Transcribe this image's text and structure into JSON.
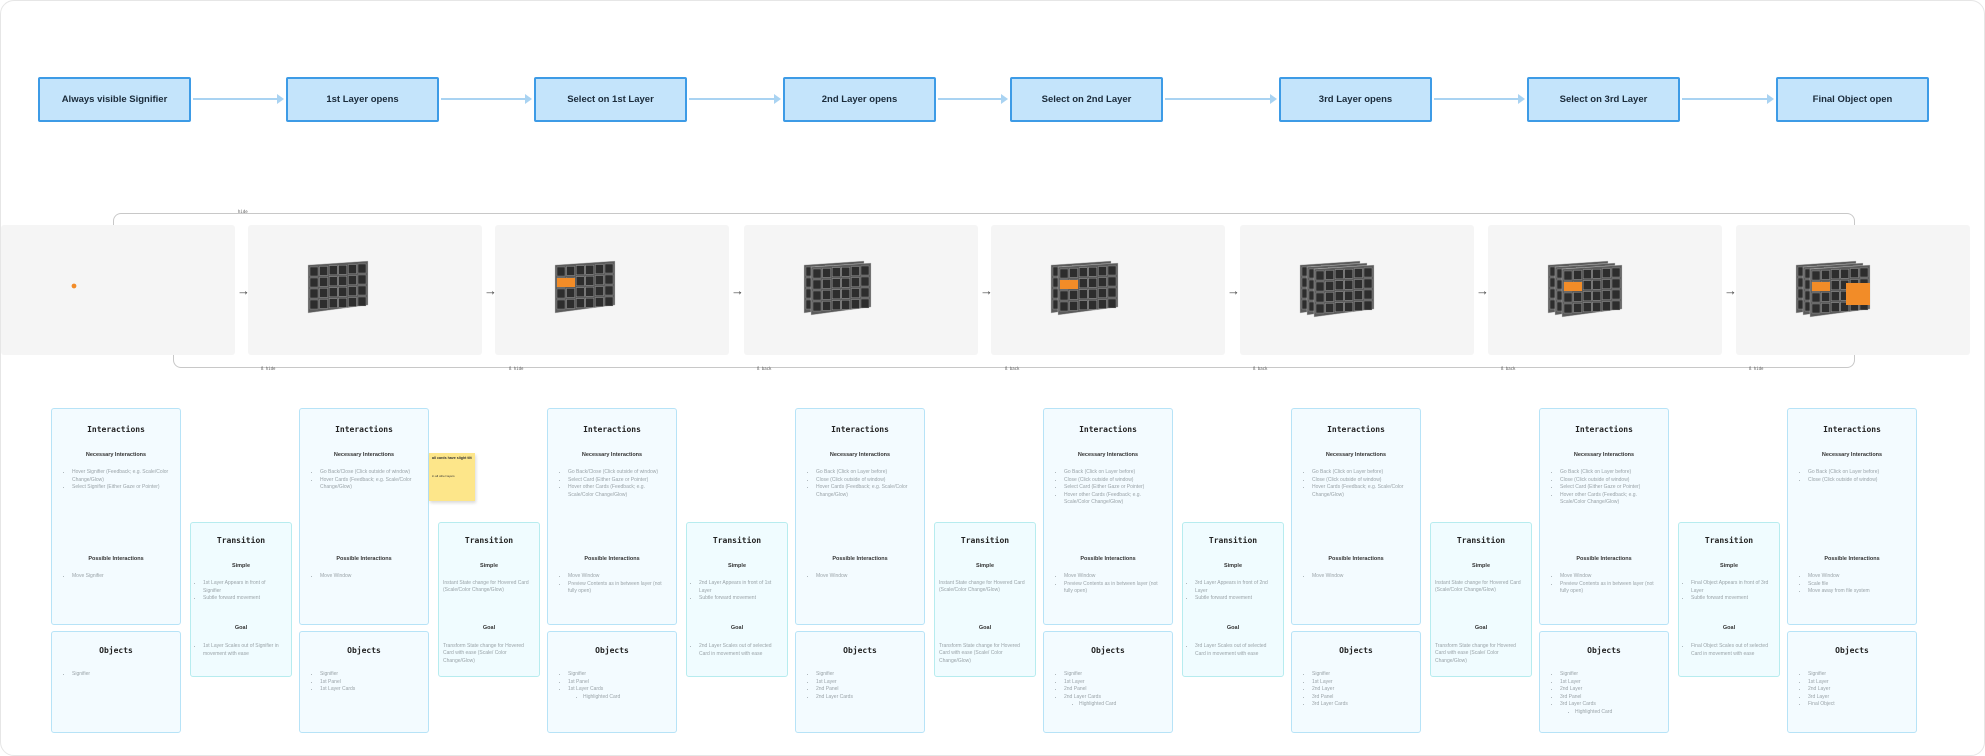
{
  "flow": {
    "nodes": [
      "Always visible Signifier",
      "1st Layer opens",
      "Select on 1st Layer",
      "2nd Layer opens",
      "Select on 2nd Layer",
      "3rd Layer opens",
      "Select on 3rd Layer",
      "Final Object open"
    ]
  },
  "shots": {
    "arrow": "→",
    "top_label": "hide",
    "bottom_labels": [
      "ß hide",
      "ß hide",
      "ß back",
      "ß back",
      "ß back",
      "ß back",
      "ß hide"
    ]
  },
  "sticky": {
    "text": "all cards have slight tilt",
    "small": "in all other layers"
  },
  "labels": {
    "interactions": "Interactions",
    "necessary": "Necessary Interactions",
    "possible": "Possible Interactions",
    "objects": "Objects",
    "transition": "Transition",
    "simple": "Simple",
    "goal": "Goal"
  },
  "columns": [
    {
      "necessary": [
        "Hover Signifier (Feedback; e.g. Scale/Color Change/Glow)",
        "Select Signifier (Either Gaze or Pointer)"
      ],
      "possible": [
        "Move Signifier"
      ],
      "objects": [
        {
          "t": "Signifier"
        }
      ]
    },
    {
      "necessary": [
        "Go Back/Close (Click outside of window)",
        "Hover Cards (Feedback; e.g. Scale/Color Change/Glow)"
      ],
      "possible": [
        "Move Window"
      ],
      "objects": [
        {
          "t": "Signifier"
        },
        {
          "t": "1st Panel"
        },
        {
          "t": "1st Layer Cards"
        }
      ]
    },
    {
      "necessary": [
        "Go Back/Close (Click outside of window)",
        "Select Card (Either Gaze or Pointer)",
        "Hover other Cards (Feedback; e.g. Scale/Color Change/Glow)"
      ],
      "possible": [
        "Move Window",
        "Preview Contents as in between layer (not fully open)"
      ],
      "objects": [
        {
          "t": "Signifier"
        },
        {
          "t": "1st Panel"
        },
        {
          "t": "1st Layer Cards"
        },
        {
          "t": "Highlighted Card",
          "n": true
        }
      ]
    },
    {
      "necessary": [
        "Go Back (Click on Layer before)",
        "Close (Click outside of window)",
        "Hover Cards (Feedback; e.g. Scale/Color Change/Glow)"
      ],
      "possible": [
        "Move Window"
      ],
      "objects": [
        {
          "t": "Signifier"
        },
        {
          "t": "1st Layer"
        },
        {
          "t": "2nd Panel"
        },
        {
          "t": "2nd Layer Cards"
        }
      ]
    },
    {
      "necessary": [
        "Go Back (Click on Layer before)",
        "Close (Click outside of window)",
        "Select Card (Either Gaze or Pointer)",
        "Hover other Cards (Feedback; e.g. Scale/Color Change/Glow)"
      ],
      "possible": [
        "Move Window",
        "Preview Contents as in between layer (not fully open)"
      ],
      "objects": [
        {
          "t": "Signifier"
        },
        {
          "t": "1st Layer"
        },
        {
          "t": "2nd Panel"
        },
        {
          "t": "2nd Layer Cards"
        },
        {
          "t": "Highlighted Card",
          "n": true
        }
      ]
    },
    {
      "necessary": [
        "Go Back (Click on Layer before)",
        "Close (Click outside of window)",
        "Hover Cards (Feedback; e.g. Scale/Color Change/Glow)"
      ],
      "possible": [
        "Move Window"
      ],
      "objects": [
        {
          "t": "Signifier"
        },
        {
          "t": "1st Layer"
        },
        {
          "t": "2nd Layer"
        },
        {
          "t": "3rd Panel"
        },
        {
          "t": "3rd Layer Cards"
        }
      ]
    },
    {
      "necessary": [
        "Go Back (Click on Layer before)",
        "Close (Click outside of window)",
        "Select Card (Either Gaze or Pointer)",
        "Hover other Cards (Feedback; e.g. Scale/Color Change/Glow)"
      ],
      "possible": [
        "Move Window",
        "Preview Contents as in between layer (not fully open)"
      ],
      "objects": [
        {
          "t": "Signifier"
        },
        {
          "t": "1st Layer"
        },
        {
          "t": "2nd Layer"
        },
        {
          "t": "3rd Panel"
        },
        {
          "t": "3rd Layer Cards"
        },
        {
          "t": "Highlighted Card",
          "n": true
        }
      ]
    },
    {
      "necessary": [
        "Go Back (Click on Layer before)",
        "Close (Click outside of window)"
      ],
      "possible": [
        "Move Window",
        "Scale file",
        "Move away from file system"
      ],
      "objects": [
        {
          "t": "Signifier"
        },
        {
          "t": "1st Layer"
        },
        {
          "t": "2nd Layer"
        },
        {
          "t": "3rd Layer"
        },
        {
          "t": "Final Object"
        }
      ]
    }
  ],
  "transitions": [
    {
      "simple": [
        "1st Layer Appears in front of Signifier",
        "Subtle forward movement"
      ],
      "simple_is_list": true,
      "goal": [
        "1st Layer Scales out of Signifier in movement with ease"
      ],
      "goal_is_list": true
    },
    {
      "simple": [
        "Instant State change for Hovered Card (Scale/Color Change/Glow)"
      ],
      "simple_is_list": false,
      "goal": [
        "Transform State change for Hovered Card with ease (Scale/ Color Change/Glow)"
      ],
      "goal_is_list": false
    },
    {
      "simple": [
        "2nd Layer Appears in front of 1st Layer",
        "Subtle forward movement"
      ],
      "simple_is_list": true,
      "goal": [
        "2nd Layer Scales out of selected Card in movement with ease"
      ],
      "goal_is_list": true
    },
    {
      "simple": [
        "Instant State change for Hovered Card (Scale/Color Change/Glow)"
      ],
      "simple_is_list": false,
      "goal": [
        "Transform State change for Hovered Card with ease (Scale/ Color Change/Glow)"
      ],
      "goal_is_list": false
    },
    {
      "simple": [
        "3rd Layer Appears in front of 2nd Layer",
        "Subtle forward movement"
      ],
      "simple_is_list": true,
      "goal": [
        "3rd Layer Scales out of selected Card in movement with ease"
      ],
      "goal_is_list": true
    },
    {
      "simple": [
        "Instant State change for Hovered Card (Scale/Color Change/Glow)"
      ],
      "simple_is_list": false,
      "goal": [
        "Transform State change for Hovered Card with ease (Scale/ Color Change/Glow)"
      ],
      "goal_is_list": false
    },
    {
      "simple": [
        "Final Object Appears in front of 3rd Layer",
        "Subtle forward movement"
      ],
      "simple_is_list": true,
      "goal": [
        "Final Object Scales out of selected Card in movement with ease"
      ],
      "goal_is_list": true
    }
  ],
  "colors": {
    "node_fill": "#c4e4fb",
    "node_border": "#3d9be6",
    "card_fill": "#f3fbff",
    "card_border": "#b7e3f7",
    "accent_orange": "#f28c28"
  }
}
